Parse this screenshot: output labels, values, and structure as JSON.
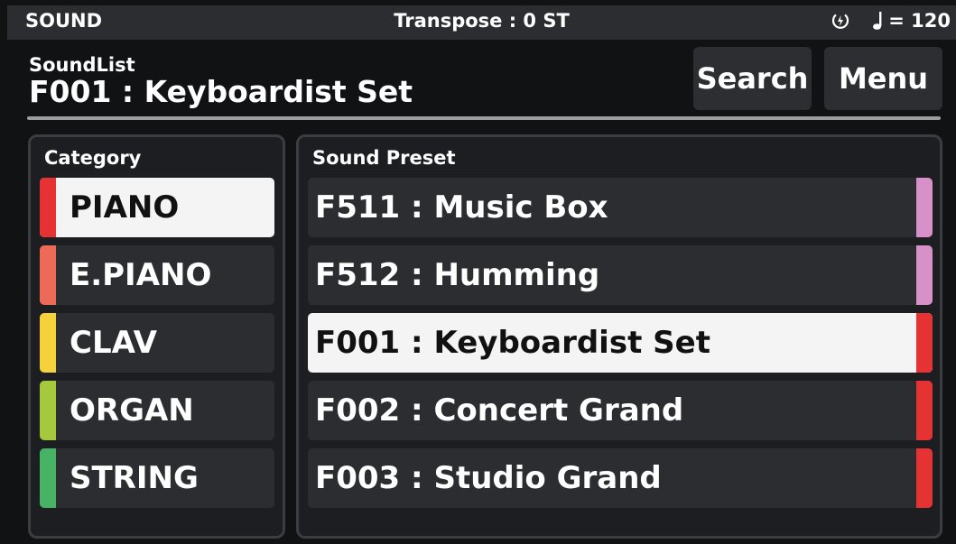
{
  "status": {
    "title": "SOUND",
    "transpose": "Transpose : 0 ST",
    "tempo": "= 120",
    "power_icon": "power-icon",
    "note_icon": "quarter-note-icon"
  },
  "header": {
    "subtitle": "SoundList",
    "title": "F001 : Keyboardist Set",
    "search_label": "Search",
    "menu_label": "Menu"
  },
  "category": {
    "label": "Category",
    "items": [
      {
        "label": "PIANO",
        "color": "#e63232",
        "selected": true
      },
      {
        "label": "E.PIANO",
        "color": "#ee6a58",
        "selected": false
      },
      {
        "label": "CLAV",
        "color": "#f5d23c",
        "selected": false
      },
      {
        "label": "ORGAN",
        "color": "#a5c83c",
        "selected": false
      },
      {
        "label": "STRING",
        "color": "#46b464",
        "selected": false
      }
    ]
  },
  "preset": {
    "label": "Sound Preset",
    "items": [
      {
        "label": "F511 : Music Box",
        "color": "#d890c8",
        "selected": false
      },
      {
        "label": "F512 : Humming",
        "color": "#d890c8",
        "selected": false
      },
      {
        "label": "F001 : Keyboardist Set",
        "color": "#e63232",
        "selected": true
      },
      {
        "label": "F002 : Concert Grand",
        "color": "#e63232",
        "selected": false
      },
      {
        "label": "F003 : Studio Grand",
        "color": "#e63232",
        "selected": false
      }
    ]
  }
}
